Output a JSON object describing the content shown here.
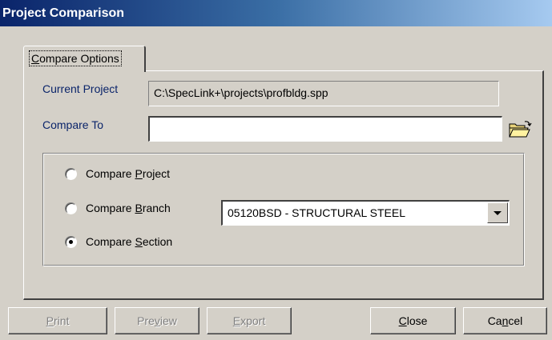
{
  "window": {
    "title": "Project Comparison"
  },
  "tab": {
    "pre": "",
    "key": "C",
    "post": "ompare Options"
  },
  "current_project": {
    "label": "Current Project",
    "value": "C:\\SpecLink+\\projects\\profbldg.spp"
  },
  "compare_to": {
    "label": "Compare To",
    "value": "",
    "icon": "folder-open-icon"
  },
  "options": {
    "project": {
      "pre": "Compare ",
      "key": "P",
      "post": "roject",
      "checked": false
    },
    "branch": {
      "pre": "Compare ",
      "key": "B",
      "post": "ranch",
      "checked": false
    },
    "section": {
      "pre": "Compare ",
      "key": "S",
      "post": "ection",
      "checked": true
    }
  },
  "branch_select": {
    "value": "05120BSD - STRUCTURAL STEEL"
  },
  "buttons": {
    "print": {
      "pre": "",
      "key": "P",
      "post": "rint",
      "enabled": false
    },
    "preview": {
      "pre": "Pre",
      "key": "v",
      "post": "iew",
      "enabled": false
    },
    "export": {
      "pre": "",
      "key": "E",
      "post": "xport",
      "enabled": false
    },
    "close": {
      "pre": "",
      "key": "C",
      "post": "lose",
      "enabled": true
    },
    "cancel": {
      "pre": "Ca",
      "key": "n",
      "post": "cel",
      "enabled": true
    }
  },
  "colors": {
    "titlebar_start": "#0a246a",
    "titlebar_end": "#a6caf0",
    "dialog_bg": "#d4d0c8",
    "label_text": "#0a246a"
  }
}
